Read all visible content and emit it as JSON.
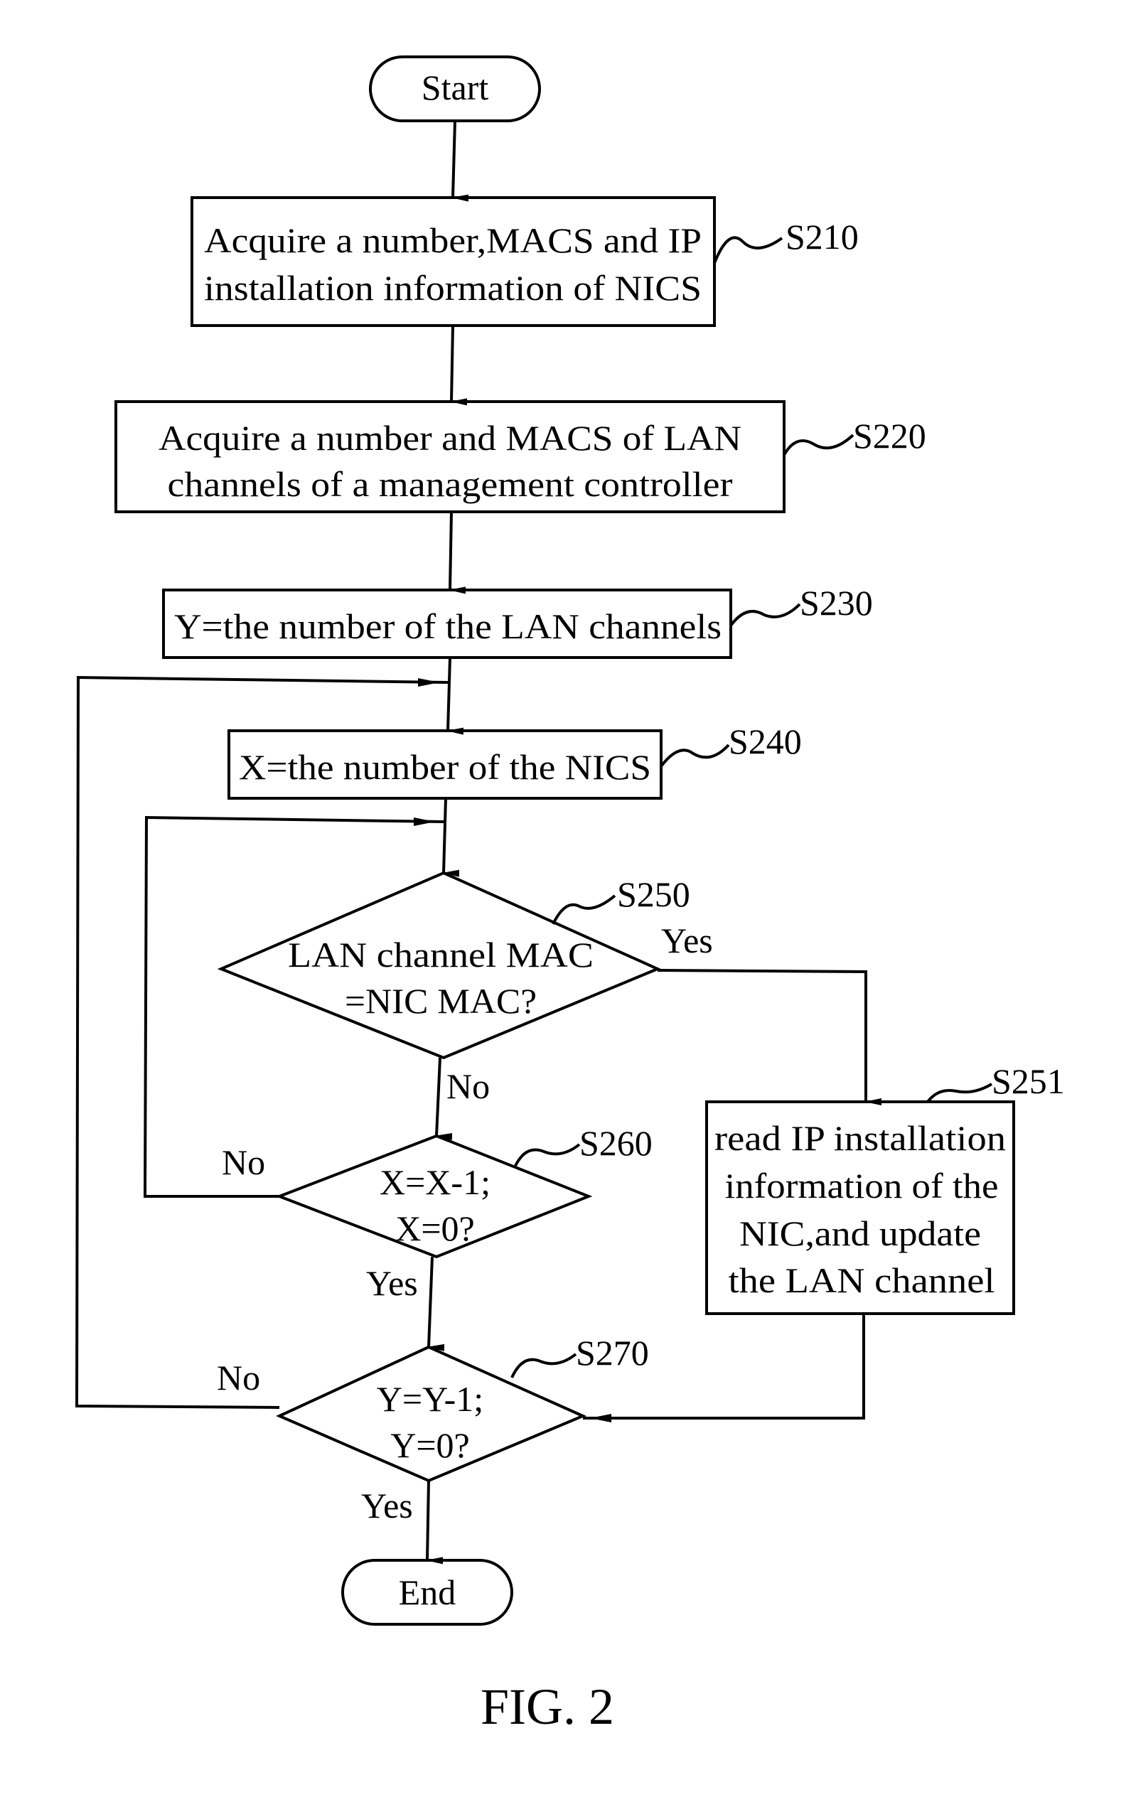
{
  "figure": {
    "caption": "FIG. 2",
    "start": "Start",
    "end": "End",
    "steps": {
      "s210": {
        "id": "S210",
        "lines": [
          "Acquire a number,MACS and IP",
          "installation information of NICS"
        ]
      },
      "s220": {
        "id": "S220",
        "lines": [
          "Acquire a number and MACS of LAN",
          "channels of a management controller"
        ]
      },
      "s230": {
        "id": "S230",
        "lines": [
          "Y=the number of the LAN channels"
        ]
      },
      "s240": {
        "id": "S240",
        "lines": [
          "X=the number of the NICS"
        ]
      },
      "s250": {
        "id": "S250",
        "lines": [
          "LAN channel MAC",
          "=NIC MAC?"
        ]
      },
      "s251": {
        "id": "S251",
        "lines": [
          "read IP installation",
          "information of the",
          "NIC,and update",
          "the LAN channel"
        ]
      },
      "s260": {
        "id": "S260",
        "lines": [
          "X=X-1;",
          "X=0?"
        ]
      },
      "s270": {
        "id": "S270",
        "lines": [
          "Y=Y-1;",
          "Y=0?"
        ]
      }
    },
    "edge_labels": {
      "s250_yes": "Yes",
      "s250_no": "No",
      "s260_no": "No",
      "s260_yes": "Yes",
      "s270_no": "No",
      "s270_yes": "Yes"
    }
  }
}
